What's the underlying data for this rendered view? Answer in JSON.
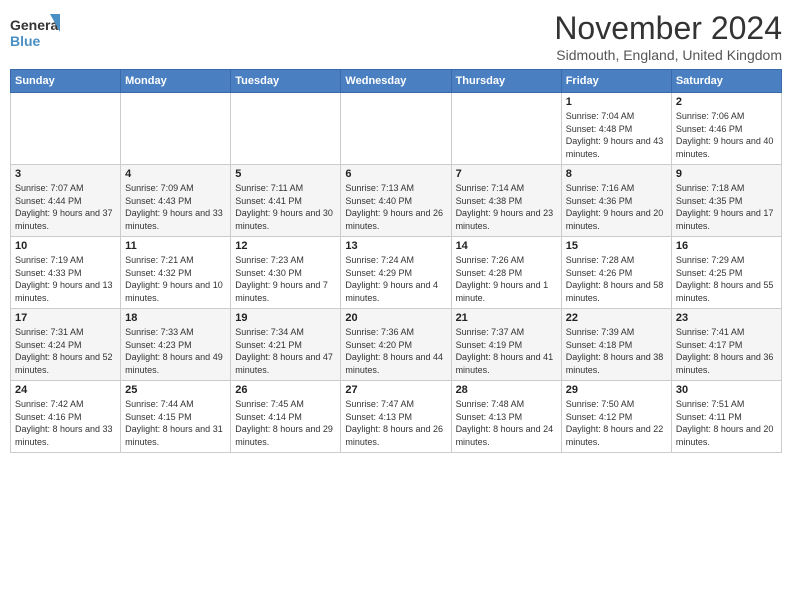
{
  "header": {
    "logo_line1": "General",
    "logo_line2": "Blue",
    "month_title": "November 2024",
    "location": "Sidmouth, England, United Kingdom"
  },
  "days_of_week": [
    "Sunday",
    "Monday",
    "Tuesday",
    "Wednesday",
    "Thursday",
    "Friday",
    "Saturday"
  ],
  "weeks": [
    [
      {
        "day": "",
        "info": ""
      },
      {
        "day": "",
        "info": ""
      },
      {
        "day": "",
        "info": ""
      },
      {
        "day": "",
        "info": ""
      },
      {
        "day": "",
        "info": ""
      },
      {
        "day": "1",
        "info": "Sunrise: 7:04 AM\nSunset: 4:48 PM\nDaylight: 9 hours and 43 minutes."
      },
      {
        "day": "2",
        "info": "Sunrise: 7:06 AM\nSunset: 4:46 PM\nDaylight: 9 hours and 40 minutes."
      }
    ],
    [
      {
        "day": "3",
        "info": "Sunrise: 7:07 AM\nSunset: 4:44 PM\nDaylight: 9 hours and 37 minutes."
      },
      {
        "day": "4",
        "info": "Sunrise: 7:09 AM\nSunset: 4:43 PM\nDaylight: 9 hours and 33 minutes."
      },
      {
        "day": "5",
        "info": "Sunrise: 7:11 AM\nSunset: 4:41 PM\nDaylight: 9 hours and 30 minutes."
      },
      {
        "day": "6",
        "info": "Sunrise: 7:13 AM\nSunset: 4:40 PM\nDaylight: 9 hours and 26 minutes."
      },
      {
        "day": "7",
        "info": "Sunrise: 7:14 AM\nSunset: 4:38 PM\nDaylight: 9 hours and 23 minutes."
      },
      {
        "day": "8",
        "info": "Sunrise: 7:16 AM\nSunset: 4:36 PM\nDaylight: 9 hours and 20 minutes."
      },
      {
        "day": "9",
        "info": "Sunrise: 7:18 AM\nSunset: 4:35 PM\nDaylight: 9 hours and 17 minutes."
      }
    ],
    [
      {
        "day": "10",
        "info": "Sunrise: 7:19 AM\nSunset: 4:33 PM\nDaylight: 9 hours and 13 minutes."
      },
      {
        "day": "11",
        "info": "Sunrise: 7:21 AM\nSunset: 4:32 PM\nDaylight: 9 hours and 10 minutes."
      },
      {
        "day": "12",
        "info": "Sunrise: 7:23 AM\nSunset: 4:30 PM\nDaylight: 9 hours and 7 minutes."
      },
      {
        "day": "13",
        "info": "Sunrise: 7:24 AM\nSunset: 4:29 PM\nDaylight: 9 hours and 4 minutes."
      },
      {
        "day": "14",
        "info": "Sunrise: 7:26 AM\nSunset: 4:28 PM\nDaylight: 9 hours and 1 minute."
      },
      {
        "day": "15",
        "info": "Sunrise: 7:28 AM\nSunset: 4:26 PM\nDaylight: 8 hours and 58 minutes."
      },
      {
        "day": "16",
        "info": "Sunrise: 7:29 AM\nSunset: 4:25 PM\nDaylight: 8 hours and 55 minutes."
      }
    ],
    [
      {
        "day": "17",
        "info": "Sunrise: 7:31 AM\nSunset: 4:24 PM\nDaylight: 8 hours and 52 minutes."
      },
      {
        "day": "18",
        "info": "Sunrise: 7:33 AM\nSunset: 4:23 PM\nDaylight: 8 hours and 49 minutes."
      },
      {
        "day": "19",
        "info": "Sunrise: 7:34 AM\nSunset: 4:21 PM\nDaylight: 8 hours and 47 minutes."
      },
      {
        "day": "20",
        "info": "Sunrise: 7:36 AM\nSunset: 4:20 PM\nDaylight: 8 hours and 44 minutes."
      },
      {
        "day": "21",
        "info": "Sunrise: 7:37 AM\nSunset: 4:19 PM\nDaylight: 8 hours and 41 minutes."
      },
      {
        "day": "22",
        "info": "Sunrise: 7:39 AM\nSunset: 4:18 PM\nDaylight: 8 hours and 38 minutes."
      },
      {
        "day": "23",
        "info": "Sunrise: 7:41 AM\nSunset: 4:17 PM\nDaylight: 8 hours and 36 minutes."
      }
    ],
    [
      {
        "day": "24",
        "info": "Sunrise: 7:42 AM\nSunset: 4:16 PM\nDaylight: 8 hours and 33 minutes."
      },
      {
        "day": "25",
        "info": "Sunrise: 7:44 AM\nSunset: 4:15 PM\nDaylight: 8 hours and 31 minutes."
      },
      {
        "day": "26",
        "info": "Sunrise: 7:45 AM\nSunset: 4:14 PM\nDaylight: 8 hours and 29 minutes."
      },
      {
        "day": "27",
        "info": "Sunrise: 7:47 AM\nSunset: 4:13 PM\nDaylight: 8 hours and 26 minutes."
      },
      {
        "day": "28",
        "info": "Sunrise: 7:48 AM\nSunset: 4:13 PM\nDaylight: 8 hours and 24 minutes."
      },
      {
        "day": "29",
        "info": "Sunrise: 7:50 AM\nSunset: 4:12 PM\nDaylight: 8 hours and 22 minutes."
      },
      {
        "day": "30",
        "info": "Sunrise: 7:51 AM\nSunset: 4:11 PM\nDaylight: 8 hours and 20 minutes."
      }
    ]
  ]
}
